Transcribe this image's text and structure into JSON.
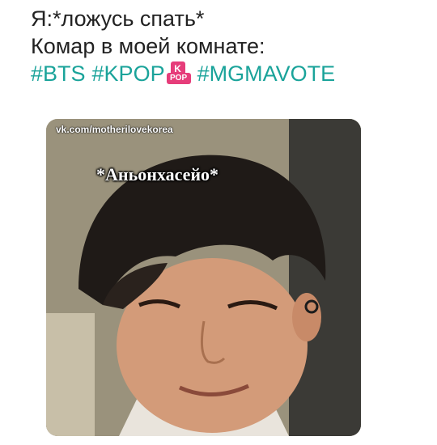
{
  "caption": {
    "line1": "Я:*ложусь спать*",
    "line2": "Комар в моей комнате:",
    "tags": {
      "tag1": "#BTS",
      "tag2": "#KPOP",
      "badge_top": "K",
      "badge_bottom": "POP",
      "tag3": "#MGMAVOTE"
    }
  },
  "photo": {
    "watermark": "vk.com/motherilovekorea",
    "speech": "*Аньонхасейо*"
  },
  "colors": {
    "hashtag": "#1aa39a",
    "badge": "#e63d7a",
    "text": "#222222"
  }
}
